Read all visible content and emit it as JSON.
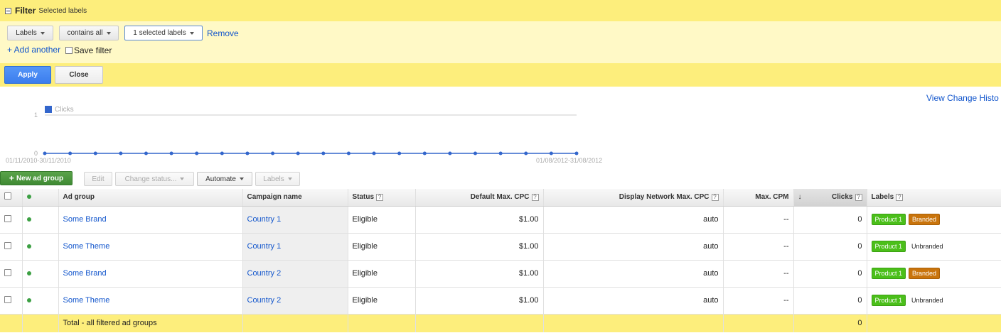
{
  "filter": {
    "title": "Filter",
    "subtitle": "Selected labels",
    "field_dropdown": "Labels",
    "operator_dropdown": "contains all",
    "value_dropdown": "1 selected labels",
    "remove": "Remove",
    "add_another": "+ Add another",
    "save_filter": "Save filter",
    "apply": "Apply",
    "close": "Close"
  },
  "view_change_history": "View Change Histo",
  "chart": {
    "legend": "Clicks",
    "legend_color": "#3366cc",
    "y_ticks": [
      "1",
      "0"
    ],
    "start_label": "01/11/2010-30/11/2010",
    "end_label": "01/08/2012-31/08/2012",
    "points": 22,
    "values": [
      0,
      0,
      0,
      0,
      0,
      0,
      0,
      0,
      0,
      0,
      0,
      0,
      0,
      0,
      0,
      0,
      0,
      0,
      0,
      0,
      0,
      0
    ]
  },
  "toolbar": {
    "new_ad_group": "New ad group",
    "edit": "Edit",
    "change_status": "Change status...",
    "automate": "Automate",
    "labels": "Labels"
  },
  "table": {
    "headers": {
      "ad_group": "Ad group",
      "campaign": "Campaign name",
      "status": "Status",
      "default_cpc": "Default Max. CPC",
      "display_cpc": "Display Network Max. CPC",
      "max_cpm": "Max. CPM",
      "clicks": "Clicks",
      "labels": "Labels"
    },
    "rows": [
      {
        "ad_group": "Some Brand",
        "campaign": "Country 1",
        "status": "Eligible",
        "default_cpc": "$1.00",
        "display_cpc": "auto",
        "max_cpm": "--",
        "clicks": "0",
        "label1": "Product 1",
        "label2": "Branded"
      },
      {
        "ad_group": "Some Theme",
        "campaign": "Country 1",
        "status": "Eligible",
        "default_cpc": "$1.00",
        "display_cpc": "auto",
        "max_cpm": "--",
        "clicks": "0",
        "label1": "Product 1",
        "label2": "Unbranded"
      },
      {
        "ad_group": "Some Brand",
        "campaign": "Country 2",
        "status": "Eligible",
        "default_cpc": "$1.00",
        "display_cpc": "auto",
        "max_cpm": "--",
        "clicks": "0",
        "label1": "Product 1",
        "label2": "Branded"
      },
      {
        "ad_group": "Some Theme",
        "campaign": "Country 2",
        "status": "Eligible",
        "default_cpc": "$1.00",
        "display_cpc": "auto",
        "max_cpm": "--",
        "clicks": "0",
        "label1": "Product 1",
        "label2": "Unbranded"
      }
    ],
    "total": {
      "label": "Total - all filtered ad groups",
      "clicks": "0"
    }
  }
}
